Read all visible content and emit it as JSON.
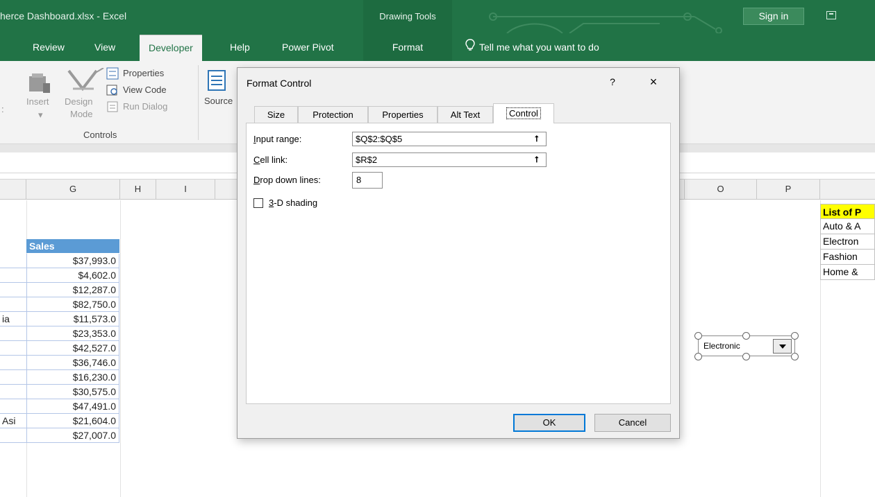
{
  "window": {
    "title": "herce Dashboard.xlsx  -  Excel",
    "context_group": "Drawing Tools",
    "sign_in": "Sign in"
  },
  "tabs": [
    {
      "label": "Review"
    },
    {
      "label": "View"
    },
    {
      "label": "Developer",
      "active": true
    },
    {
      "label": "Help"
    },
    {
      "label": "Power Pivot"
    },
    {
      "label": "Format"
    }
  ],
  "tell_me": "Tell me what you want to do",
  "ribbon": {
    "insert_label": "Insert",
    "design_mode_line1": "Design",
    "design_mode_line2": "Mode",
    "properties": "Properties",
    "view_code": "View Code",
    "run_dialog": "Run Dialog",
    "group_controls": "Controls",
    "source": "Source"
  },
  "columns": [
    "G",
    "H",
    "I",
    "O",
    "P"
  ],
  "sheet": {
    "sales_header": "Sales",
    "sales": [
      "$37,993.0",
      "$4,602.0",
      "$12,287.0",
      "$82,750.0",
      "$11,573.0",
      "$23,353.0",
      "$42,527.0",
      "$36,746.0",
      "$16,230.0",
      "$30,575.0",
      "$47,491.0",
      "$21,604.0",
      "$27,007.0"
    ],
    "left_fragments": [
      "",
      "",
      "",
      "",
      "ia",
      "",
      "",
      "",
      "",
      "",
      "",
      "Asi",
      ""
    ],
    "list_header": "List of P",
    "list_items": [
      "Auto & A",
      "Electron",
      "Fashion",
      "Home &"
    ]
  },
  "combo_box": {
    "value": "Electronic"
  },
  "dialog": {
    "title": "Format Control",
    "help": "?",
    "close": "×",
    "tabs": [
      "Size",
      "Protection",
      "Properties",
      "Alt Text",
      "Control"
    ],
    "active_tab": "Control",
    "input_range_label_u": "I",
    "input_range_label_rest": "nput range:",
    "input_range_value": "$Q$2:$Q$5",
    "cell_link_label_u": "C",
    "cell_link_label_rest": "ell link:",
    "cell_link_value": "$R$2",
    "drop_down_label_u": "D",
    "drop_down_label_rest": "rop down lines:",
    "drop_down_value": "8",
    "shading_label_u": "3",
    "shading_label_rest": "-D shading",
    "shading_checked": false,
    "ok": "OK",
    "cancel": "Cancel"
  },
  "colors": {
    "excel_green": "#217346",
    "table_header_blue": "#5b9bd5",
    "highlight_yellow": "#ffff00",
    "default_button_border": "#0078d7"
  }
}
